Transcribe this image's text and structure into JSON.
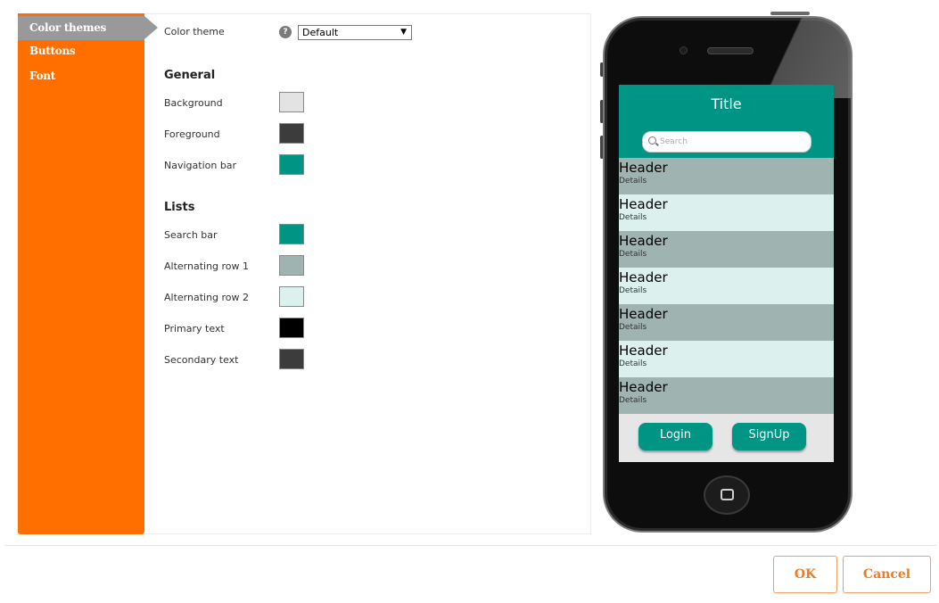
{
  "sidebar": {
    "items": [
      {
        "label": "Color themes"
      },
      {
        "label": "Buttons"
      },
      {
        "label": "Font"
      }
    ]
  },
  "settings": {
    "color_theme_label": "Color theme",
    "color_theme_value": "Default",
    "help_icon": "?",
    "general_heading": "General",
    "general": [
      {
        "label": "Background",
        "color": "#e3e3e3"
      },
      {
        "label": "Foreground",
        "color": "#3c3c3c"
      },
      {
        "label": "Navigation bar",
        "color": "#009484"
      }
    ],
    "lists_heading": "Lists",
    "lists": [
      {
        "label": "Search bar",
        "color": "#009484"
      },
      {
        "label": "Alternating row 1",
        "color": "#9fb3b0"
      },
      {
        "label": "Alternating row 2",
        "color": "#dcf0ee"
      },
      {
        "label": "Primary text",
        "color": "#000000"
      },
      {
        "label": "Secondary text",
        "color": "#3c3c3c"
      }
    ]
  },
  "preview": {
    "title": "Title",
    "search_placeholder": "Search",
    "rows": [
      {
        "header": "Header",
        "details": "Details",
        "color": "#9fb3b0"
      },
      {
        "header": "Header",
        "details": "Details",
        "color": "#dcf0ee"
      },
      {
        "header": "Header",
        "details": "Details",
        "color": "#9fb3b0"
      },
      {
        "header": "Header",
        "details": "Details",
        "color": "#dcf0ee"
      },
      {
        "header": "Header",
        "details": "Details",
        "color": "#9fb3b0"
      },
      {
        "header": "Header",
        "details": "Details",
        "color": "#dcf0ee"
      },
      {
        "header": "Header",
        "details": "Details",
        "color": "#9fb3b0"
      }
    ],
    "login_label": "Login",
    "signup_label": "SignUp"
  },
  "footer": {
    "ok_label": "OK",
    "cancel_label": "Cancel"
  },
  "colors": {
    "sidebar": "#ff6f00",
    "sidebar_active": "#999999",
    "accent": "#f07a1e",
    "teal": "#009484"
  }
}
